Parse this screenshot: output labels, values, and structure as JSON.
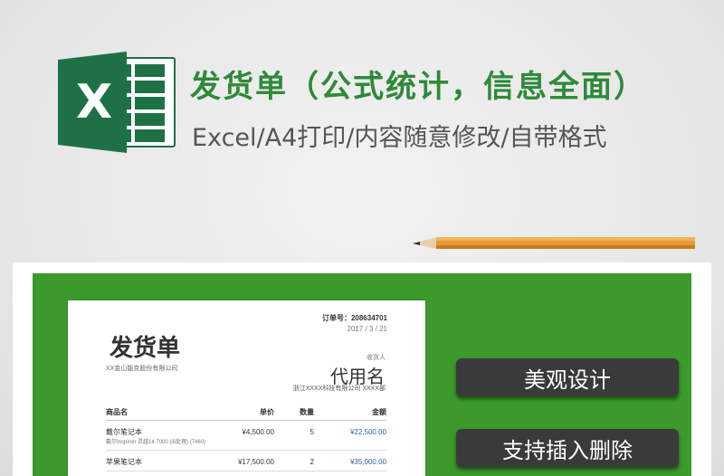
{
  "header": {
    "title": "发货单（公式统计，信息全面）",
    "subtitle": "Excel/A4打印/内容随意修改/自带格式",
    "logo_letter": "X",
    "logo_icon": "excel-icon"
  },
  "colors": {
    "excel_green": "#1e7145",
    "title_green": "#2e8a3a",
    "panel_green": "#3b9a2b",
    "button_dark": "#3a3a3a",
    "amount_blue": "#2a5db0"
  },
  "invoice": {
    "order_no": "订单号：208634701",
    "date": "2017 / 3 / 21",
    "title": "发货单",
    "company": "XX金山能克股份有限公司",
    "recipient_label": "收货人",
    "recipient_name": "代用名",
    "recipient_address": "浙江XXXX科技有限公司 XXXX部",
    "columns": [
      "商品名",
      "单价",
      "数量",
      "金额"
    ],
    "items": [
      {
        "name": "戴尔笔记本",
        "desc": "戴尔Inspiron 灵越14 7000 (i5处理) (7460)",
        "price": "¥4,500.00",
        "qty": "5",
        "amount": "¥22,500.00"
      },
      {
        "name": "苹果笔记本",
        "desc": "",
        "price": "¥17,500.00",
        "qty": "2",
        "amount": "¥35,000.00"
      }
    ]
  },
  "buttons": {
    "design": "美观设计",
    "insert_delete": "支持插入删除"
  }
}
